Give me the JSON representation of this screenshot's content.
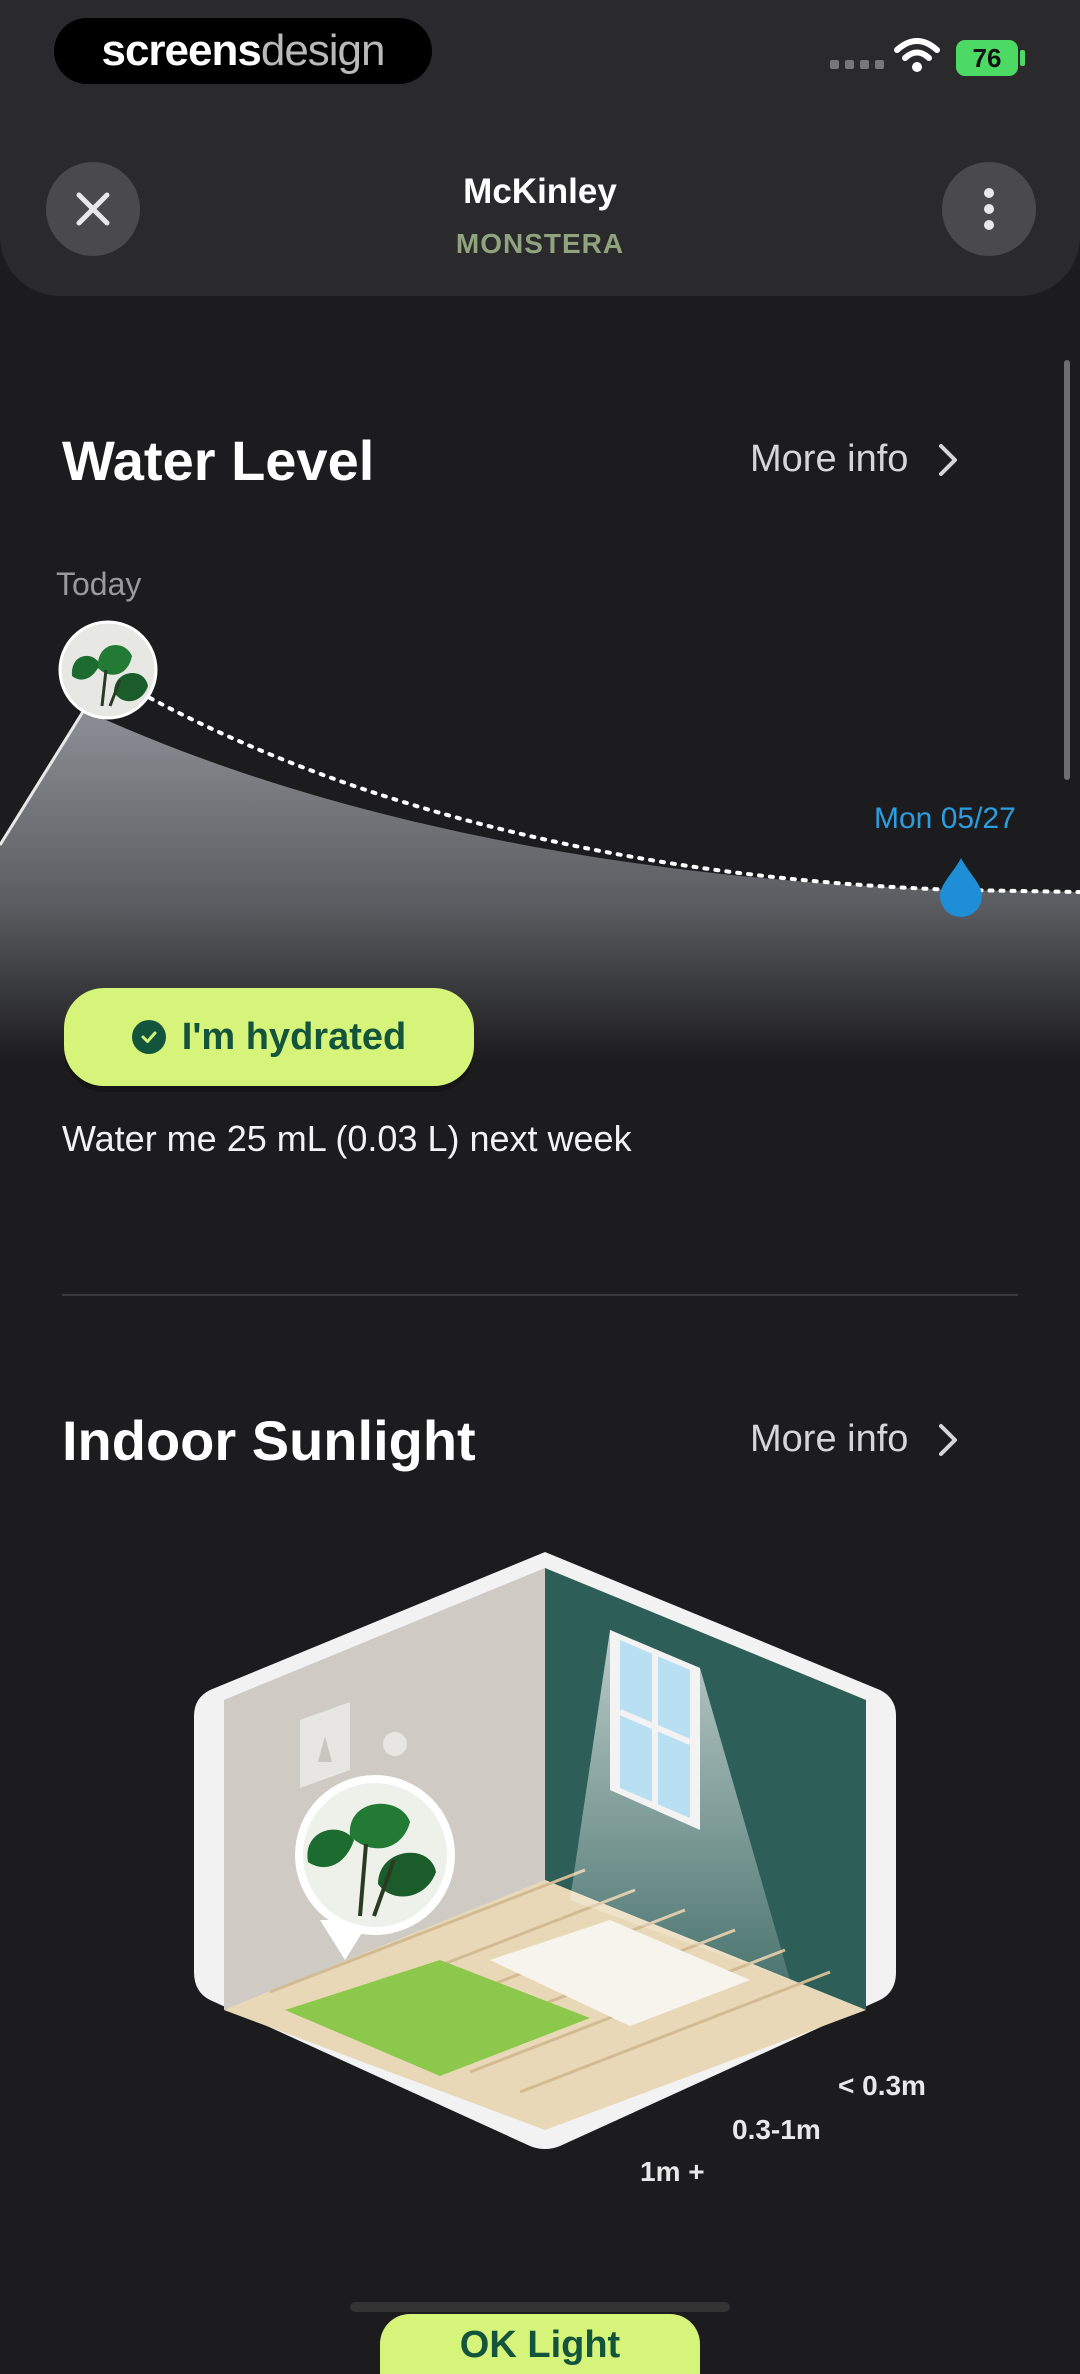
{
  "status_bar": {
    "brand_part1": "screens",
    "brand_part2": "design",
    "battery": "76"
  },
  "header": {
    "title": "McKinley",
    "subtitle": "MONSTERA",
    "close_icon": "close-icon",
    "more_icon": "more-vertical-icon"
  },
  "water": {
    "title": "Water Level",
    "more_info": "More info",
    "today_label": "Today",
    "next_date": "Mon 05/27",
    "status": "I'm hydrated",
    "note": "Water me 25 mL (0.03 L) next week"
  },
  "sunlight": {
    "title": "Indoor Sunlight",
    "more_info": "More info",
    "distances": [
      "< 0.3m",
      "0.3-1m",
      "1m +"
    ],
    "status": "OK Light"
  },
  "colors": {
    "accent_green": "#d6f37a",
    "dark_green": "#13543c",
    "water_blue": "#2c9ee0"
  }
}
